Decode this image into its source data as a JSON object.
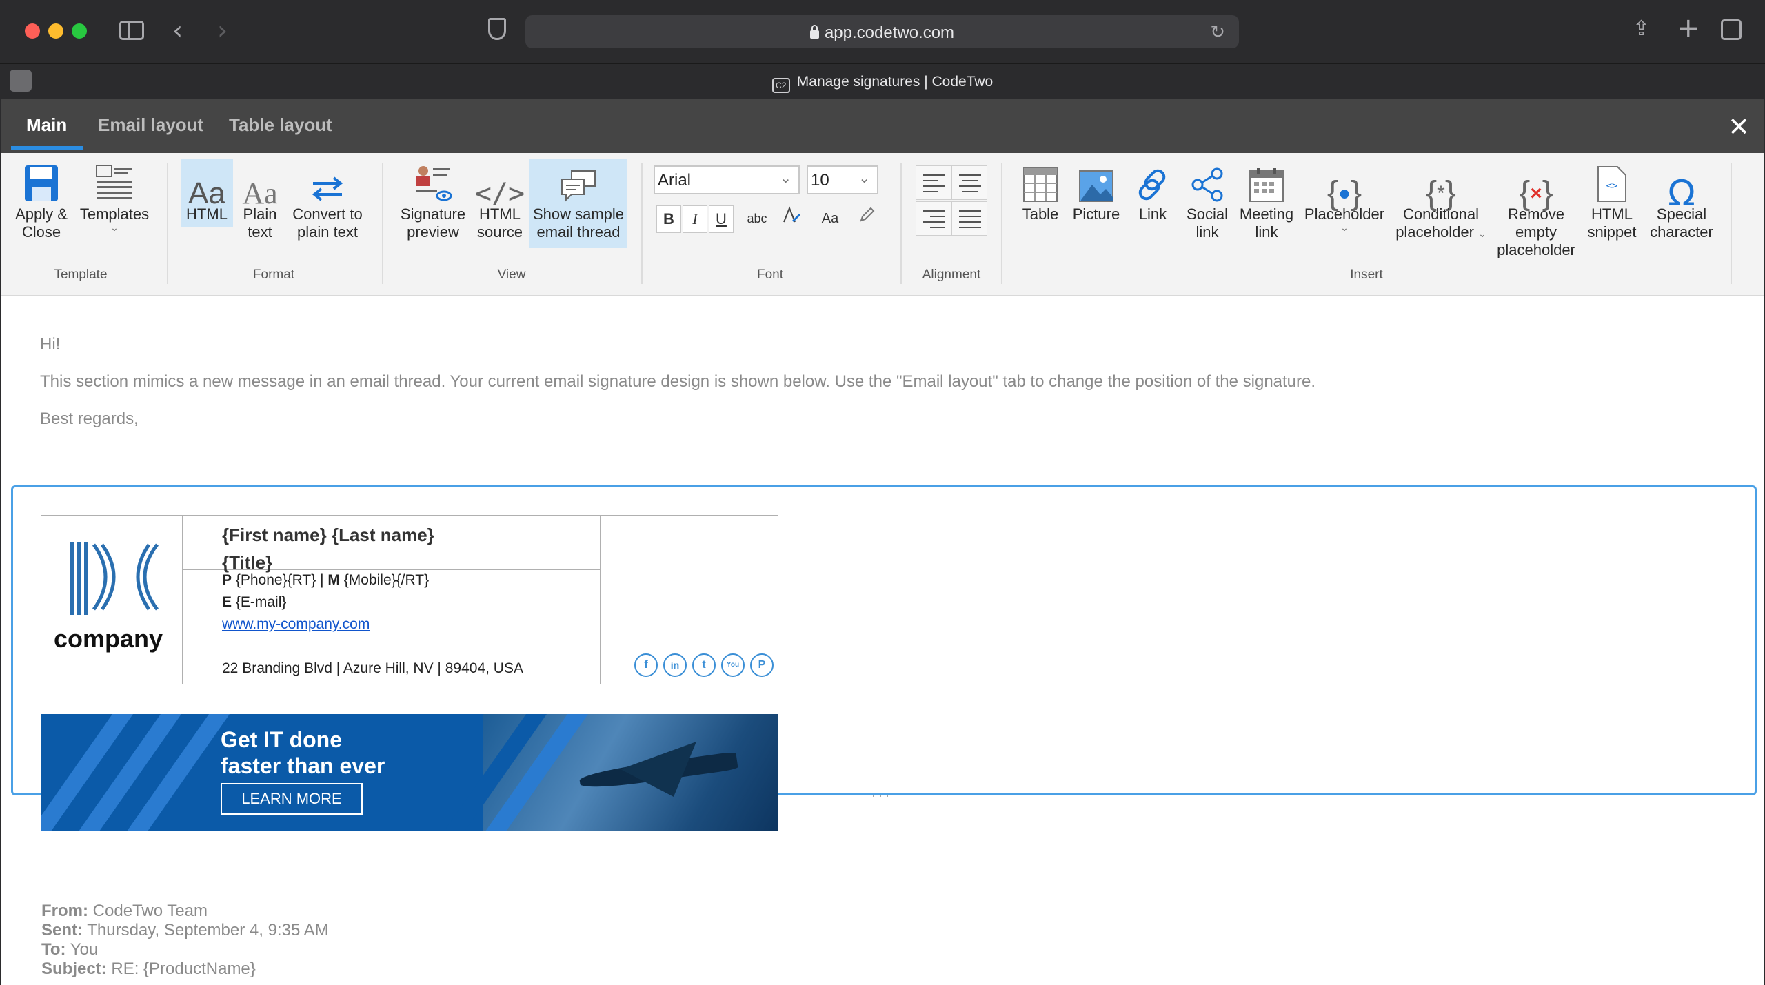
{
  "browser": {
    "url": "app.codetwo.com",
    "page_title": "Manage signatures | CodeTwo",
    "favicon_text": "C2"
  },
  "ribbon_tabs": [
    {
      "label": "Main",
      "active": true
    },
    {
      "label": "Email layout",
      "active": false
    },
    {
      "label": "Table layout",
      "active": false
    }
  ],
  "ribbon": {
    "template": {
      "group": "Template",
      "apply_close": [
        "Apply &",
        "Close"
      ],
      "templates": "Templates"
    },
    "format": {
      "group": "Format",
      "html": "HTML",
      "plain": [
        "Plain",
        "text"
      ],
      "convert": [
        "Convert to",
        "plain text"
      ]
    },
    "view": {
      "group": "View",
      "sig_preview": [
        "Signature",
        "preview"
      ],
      "html_source": [
        "HTML",
        "source"
      ],
      "sample_thread": [
        "Show sample",
        "email thread"
      ]
    },
    "font": {
      "group": "Font",
      "family": "Arial",
      "size": "10",
      "bold": "B",
      "italic": "I",
      "underline": "U",
      "strike": "abc",
      "case": "Aa"
    },
    "alignment": {
      "group": "Alignment"
    },
    "insert": {
      "group": "Insert",
      "table": "Table",
      "picture": "Picture",
      "link": "Link",
      "social": [
        "Social",
        "link"
      ],
      "meeting": [
        "Meeting",
        "link"
      ],
      "placeholder": "Placeholder",
      "conditional": [
        "Conditional",
        "placeholder"
      ],
      "remove_empty": [
        "Remove",
        "empty",
        "placeholder"
      ],
      "snippet": [
        "HTML",
        "snippet"
      ],
      "special": [
        "Special",
        "character"
      ]
    }
  },
  "message": {
    "greeting": "Hi!",
    "body": "This section mimics a new message in an email thread. Your current email signature design is shown below. Use the \"Email layout\" tab to change the position of the signature.",
    "closing": "Best regards,"
  },
  "signature": {
    "logo_text": "company",
    "name_line": "{First name} {Last name}",
    "title_line": "{Title}",
    "phone_prefix_p": "P",
    "phone_value": "{Phone}{RT}",
    "phone_sep": "|",
    "phone_prefix_m": "M",
    "mobile_value": "{Mobile}{/RT}",
    "email_prefix": "E",
    "email_value": "{E-mail}",
    "website": "www.my-company.com",
    "address": "22 Branding Blvd | Azure Hill, NV | 89404, USA",
    "social": [
      "f",
      "in",
      "t",
      "You",
      "P"
    ],
    "banner": {
      "line1": "Get IT done",
      "line2": "faster than ever",
      "button": "LEARN MORE"
    }
  },
  "thread": {
    "from_label": "From:",
    "from": "CodeTwo Team",
    "sent_label": "Sent:",
    "sent": "Thursday, September 4, 9:35 AM",
    "to_label": "To:",
    "to": "You",
    "subject_label": "Subject:",
    "subject": "RE: {ProductName}"
  },
  "colors": {
    "accent": "#2b8de2",
    "selected": "#cfe6f7",
    "banner": "#0b5aa8"
  }
}
